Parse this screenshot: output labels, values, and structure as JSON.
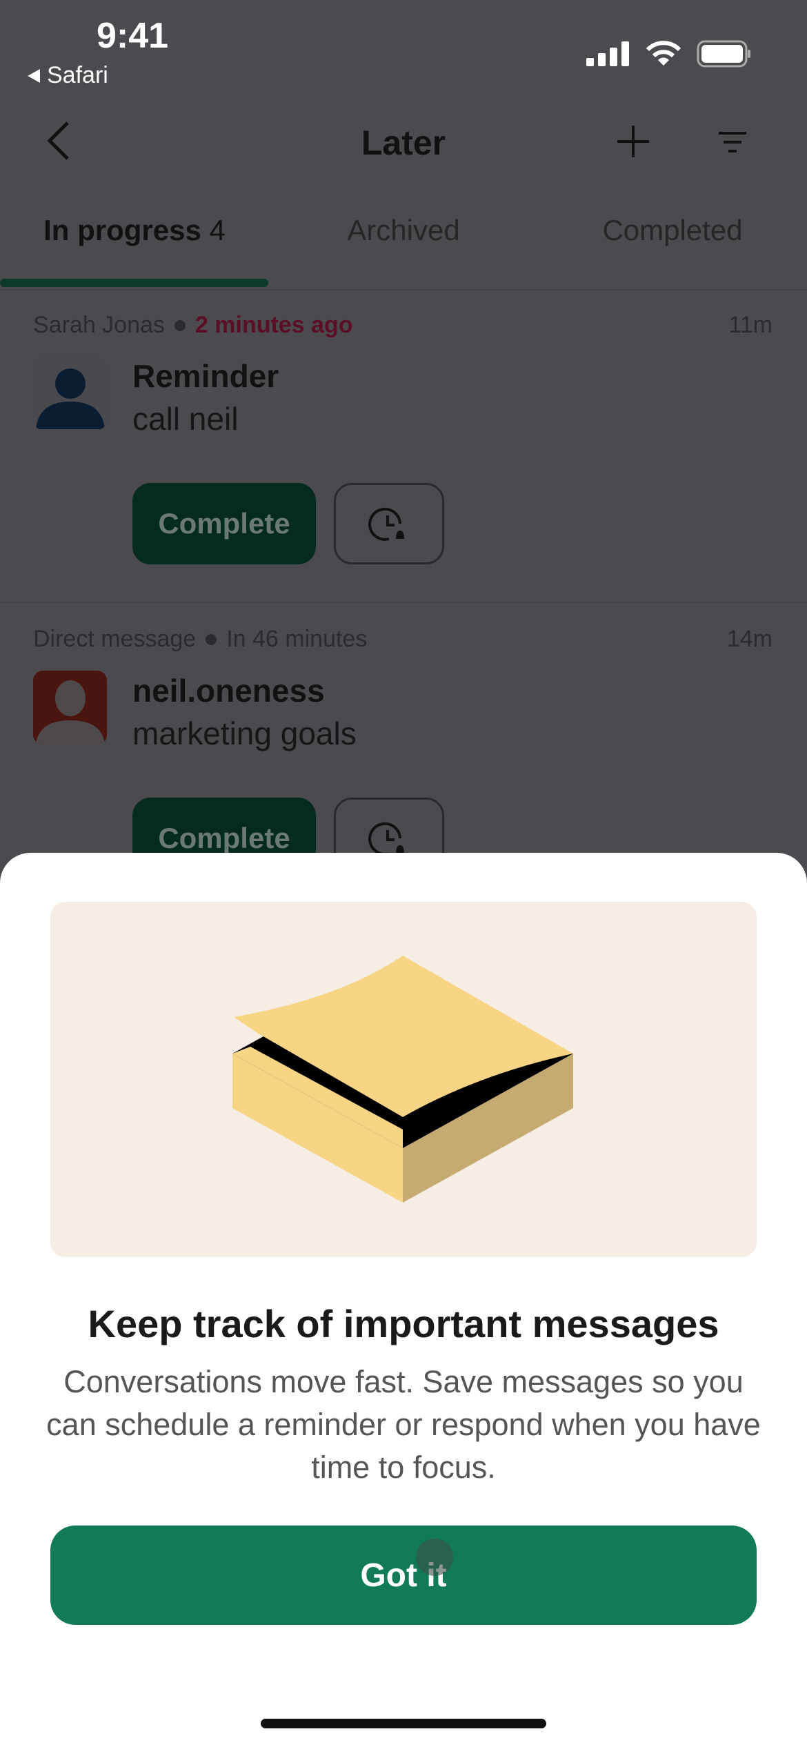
{
  "status_bar": {
    "time": "9:41",
    "back_app": "Safari"
  },
  "header": {
    "title": "Later"
  },
  "tabs": [
    {
      "label": "In progress",
      "count": "4",
      "active": true
    },
    {
      "label": "Archived"
    },
    {
      "label": "Completed"
    }
  ],
  "items": [
    {
      "source": "Sarah Jonas",
      "when": "2 minutes ago",
      "when_color": "#5a0f25",
      "age": "11m",
      "title": "Reminder",
      "body": "call neil",
      "complete_label": "Complete",
      "avatar_color": "#4a4a4e"
    },
    {
      "source": "Direct message",
      "when": "In 46 minutes",
      "age": "14m",
      "title": "neil.oneness",
      "body": "marketing goals",
      "complete_label": "Complete",
      "avatar_color": "#4a1510"
    }
  ],
  "sheet": {
    "heading": "Keep track of important messages",
    "description": "Conversations move fast. Save messages so you can schedule a reminder or respond when you have time to focus.",
    "button_label": "Got it",
    "accent": "#117a56"
  }
}
